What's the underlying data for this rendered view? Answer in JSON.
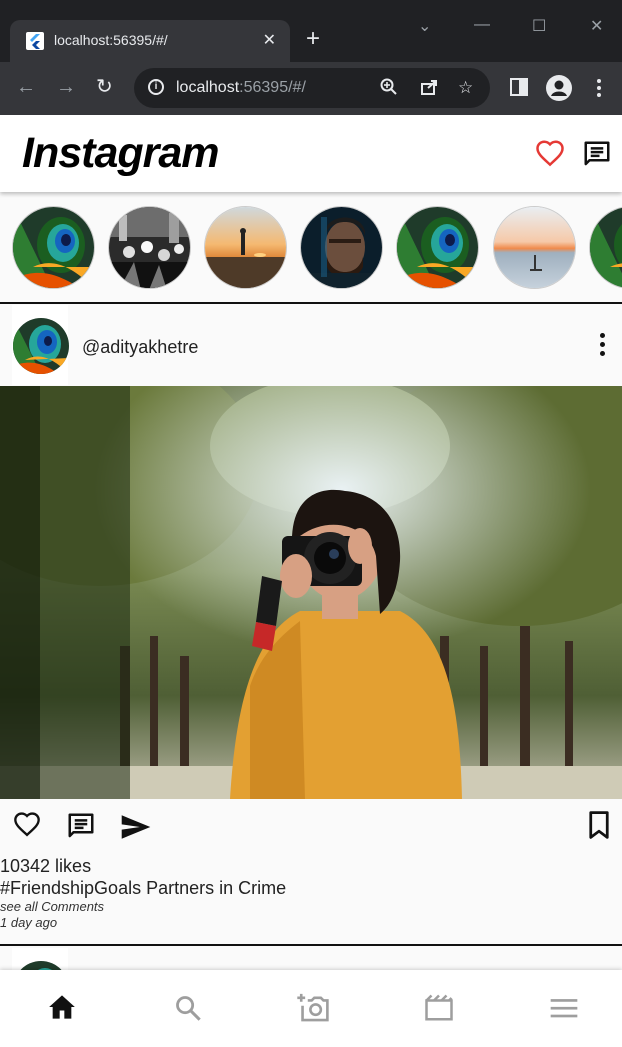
{
  "browser": {
    "tab_title": "localhost:56395/#/",
    "url_host": "localhost",
    "url_rest": ":56395/#/"
  },
  "app": {
    "logo": "Instagram",
    "colors": {
      "heart": "#e53935",
      "text": "#222222",
      "icon_grey": "#9e9e9e"
    },
    "icons": {
      "appbar": [
        "heart-outline-icon",
        "chat-icon"
      ],
      "bottom_nav": [
        "home-icon",
        "search-icon",
        "add-photo-icon",
        "movie-icon",
        "menu-icon"
      ]
    },
    "stories": [
      "story-peacock",
      "story-crowd",
      "story-sunset-man",
      "story-man-portrait",
      "story-peacock",
      "story-sea-sunset",
      "story-peacock"
    ],
    "post": {
      "username": "@adityakhetre",
      "likes": "10342 likes",
      "caption": "#FriendshipGoals Partners in Crime",
      "see_all": "see all Comments",
      "time_ago": "1 day ago"
    }
  }
}
